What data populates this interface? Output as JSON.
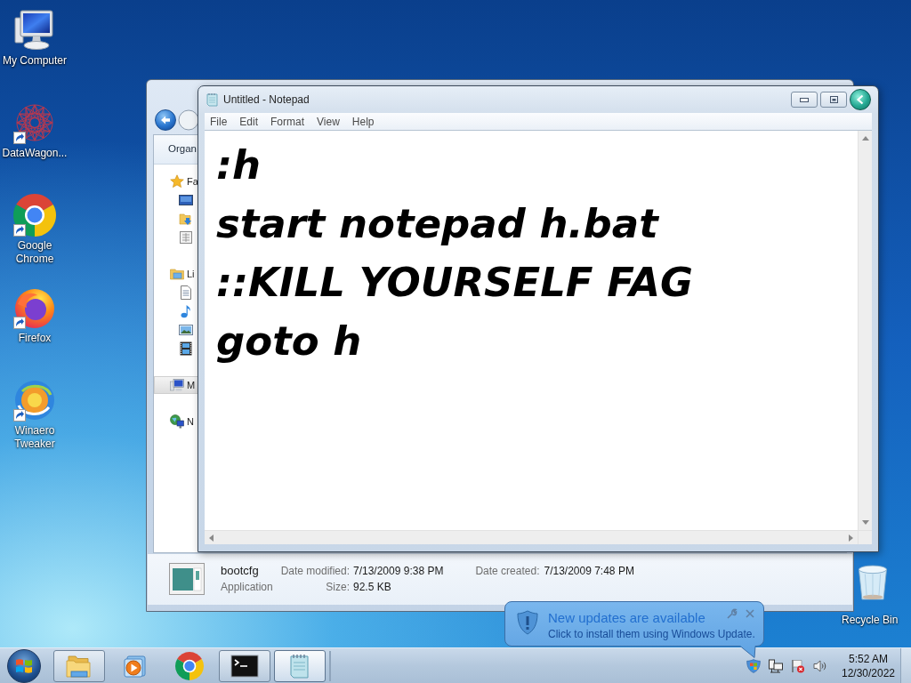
{
  "desktop_icons": [
    {
      "label": "My Computer",
      "kind": "computer",
      "shortcut": false
    },
    {
      "label": "DataWagon...",
      "kind": "mesh",
      "shortcut": true
    },
    {
      "label": "Google Chrome",
      "kind": "chrome",
      "shortcut": true
    },
    {
      "label": "Firefox",
      "kind": "firefox",
      "shortcut": true
    },
    {
      "label": "Winaero Tweaker",
      "kind": "swirl",
      "shortcut": true
    }
  ],
  "recycle_bin": {
    "label": "Recycle Bin"
  },
  "explorer": {
    "toolbar_button": "Organ",
    "nav_groups": [
      {
        "label": "Fa",
        "kind": "favorites",
        "selected": false,
        "children": [
          {
            "kind": "desktop"
          },
          {
            "kind": "downloads"
          },
          {
            "kind": "recent"
          }
        ]
      },
      {
        "label": "Li",
        "kind": "libraries",
        "selected": false,
        "children": [
          {
            "kind": "documents"
          },
          {
            "kind": "music"
          },
          {
            "kind": "pictures"
          },
          {
            "kind": "videos"
          }
        ]
      },
      {
        "label": "M",
        "kind": "computer",
        "selected": true
      },
      {
        "label": "N",
        "kind": "network",
        "selected": false
      }
    ],
    "details": {
      "name": "bootcfg",
      "type": "Application",
      "properties": [
        {
          "label": "Date modified:",
          "value": "7/13/2009 9:38 PM"
        },
        {
          "label": "Size:",
          "value": "92.5 KB"
        },
        {
          "label": "Date created:",
          "value": "7/13/2009 7:48 PM"
        }
      ]
    }
  },
  "notepad": {
    "title": "Untitled - Notepad",
    "menu": [
      "File",
      "Edit",
      "Format",
      "View",
      "Help"
    ],
    "lines": [
      ":h",
      "start notepad h.bat",
      "::KILL YOURSELF FAG",
      "goto h"
    ]
  },
  "notification": {
    "title": "New updates are available",
    "message": "Click to install them using Windows Update."
  },
  "taskbar": {
    "apps": [
      {
        "kind": "explorer",
        "open": true,
        "selected": false
      },
      {
        "kind": "media_player",
        "open": false,
        "selected": false
      },
      {
        "kind": "chrome",
        "open": false,
        "selected": false
      },
      {
        "kind": "cmd",
        "open": true,
        "selected": false
      },
      {
        "kind": "notepad",
        "open": true,
        "selected": true
      }
    ],
    "tray": [
      {
        "kind": "update"
      },
      {
        "kind": "network"
      },
      {
        "kind": "action_center"
      },
      {
        "kind": "volume"
      }
    ],
    "clock": {
      "time": "5:52 AM",
      "date": "12/30/2022"
    }
  }
}
